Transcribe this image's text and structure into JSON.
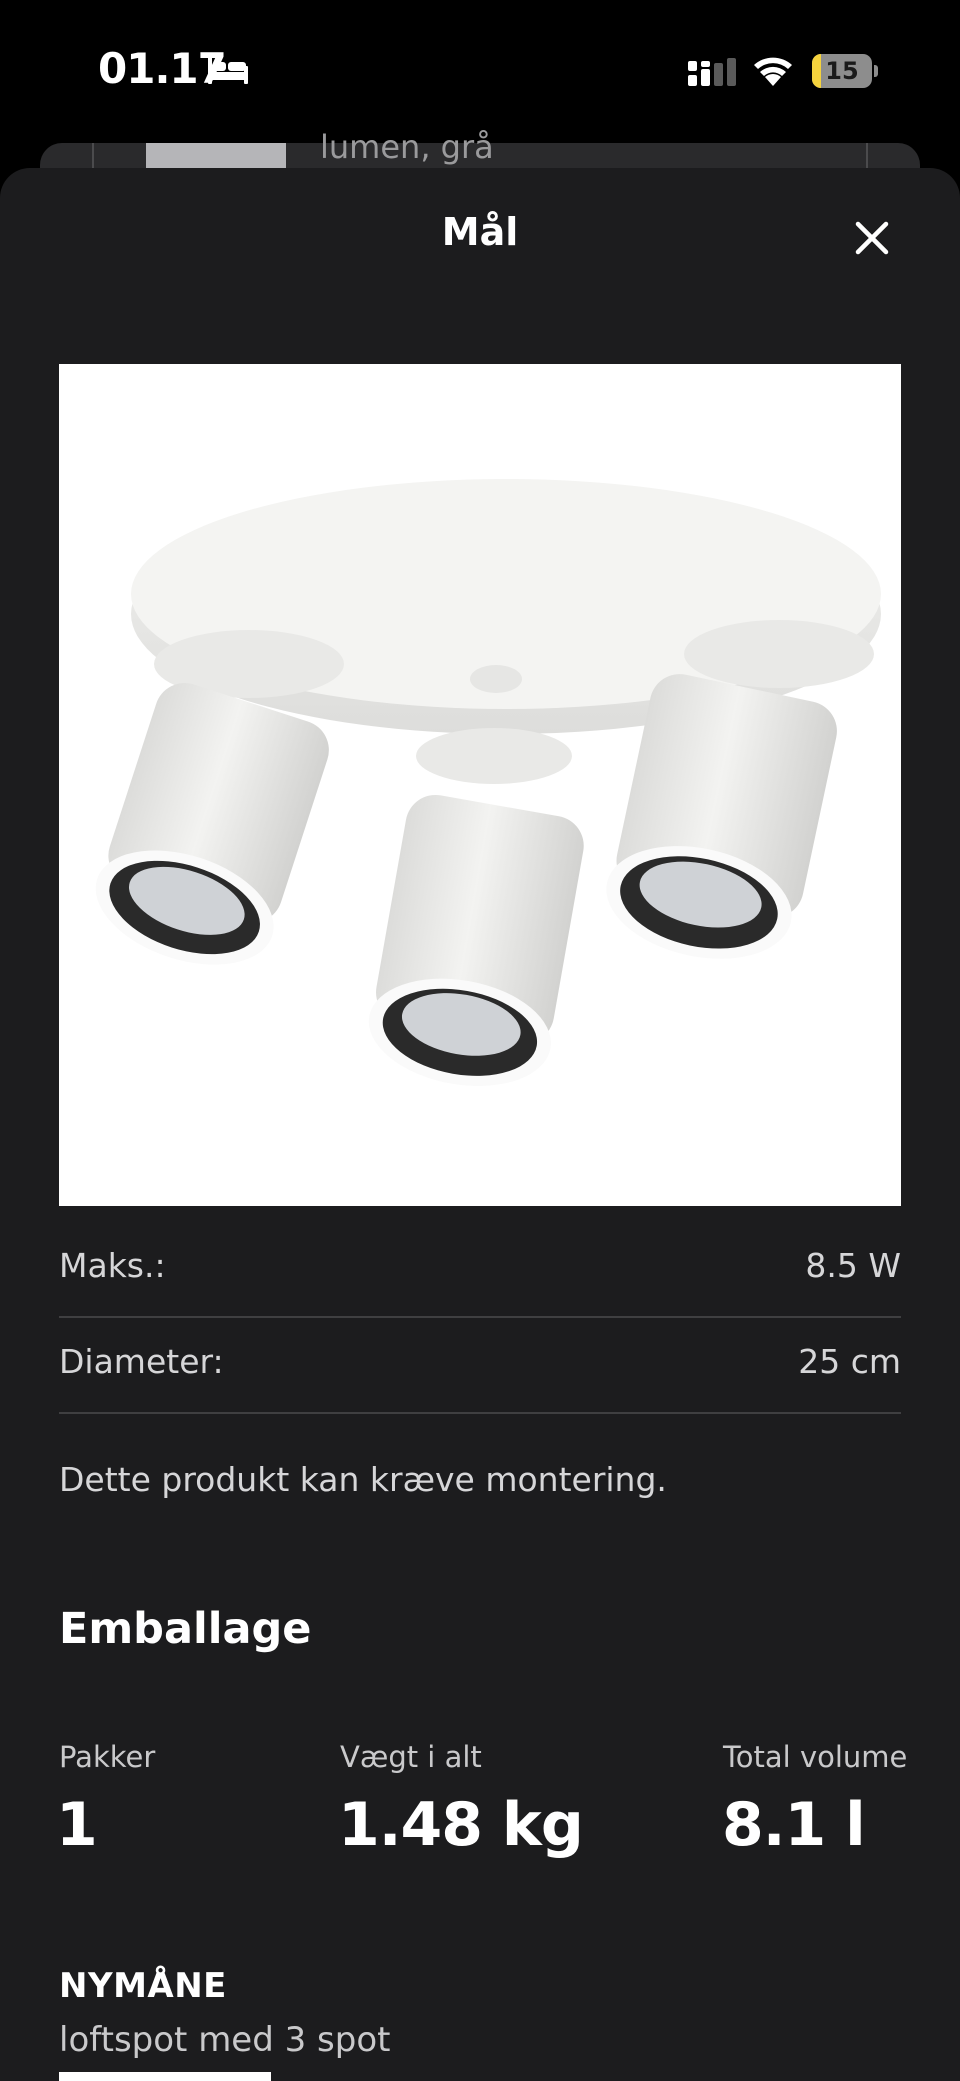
{
  "status_bar": {
    "time": "01.17",
    "battery_level": "15",
    "battery_fraction": 0.15,
    "icons": [
      "bed-icon",
      "cellular-signal-icon",
      "wifi-icon",
      "battery-icon"
    ]
  },
  "background_item": {
    "text": "lumen, grå"
  },
  "sheet": {
    "title": "Mål",
    "close_icon": "close-icon"
  },
  "specs": [
    {
      "label": "Maks.:",
      "value": "8.5 W"
    },
    {
      "label": "Diameter:",
      "value": "25 cm"
    }
  ],
  "note": "Dette produkt kan kræve montering.",
  "packaging": {
    "title": "Emballage",
    "columns": [
      {
        "label": "Pakker",
        "value": "1"
      },
      {
        "label": "Vægt i alt",
        "value": "1.48 kg"
      },
      {
        "label": "Total volume",
        "value": "8.1 l"
      }
    ]
  },
  "product": {
    "name": "NYMÅNE",
    "description": "loftspot med 3 spot"
  },
  "colors": {
    "sheet_background": "#1c1c1e",
    "divider": "#3f3f41",
    "text_primary": "#ffffff",
    "text_secondary": "#d6d6d8",
    "battery_low": "#f5d33d"
  }
}
